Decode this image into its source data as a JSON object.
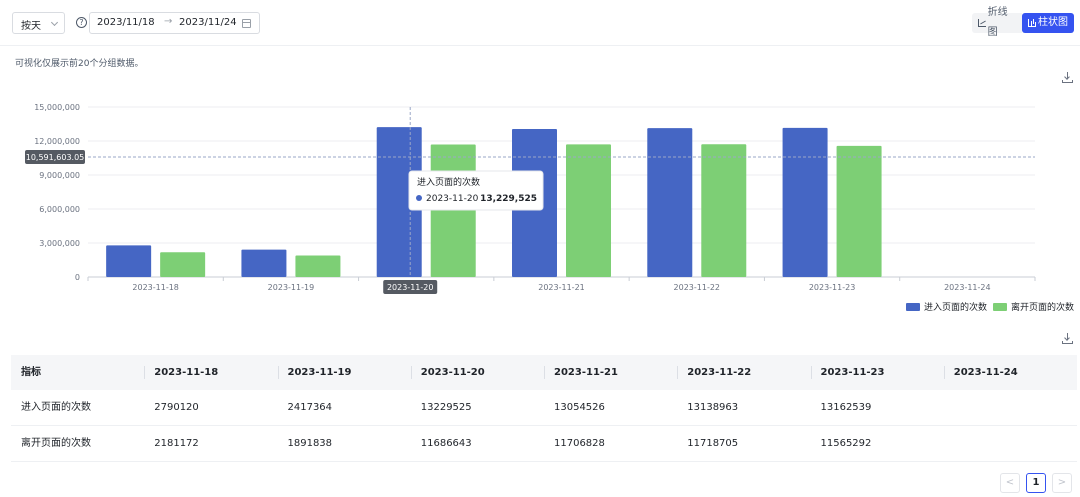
{
  "toolbar": {
    "group_by": "按天",
    "date_start": "2023/11/18",
    "date_sep": "→",
    "date_end": "2023/11/24",
    "view_line_label": "折线图",
    "view_bar_label": "柱状图"
  },
  "note": "可视化仅展示前20个分组数据。",
  "colors": {
    "enter": "#4566c4",
    "leave": "#7dcf75",
    "accent": "#3553f0"
  },
  "chart_data": {
    "type": "bar",
    "categories": [
      "2023-11-18",
      "2023-11-19",
      "2023-11-20",
      "2023-11-21",
      "2023-11-22",
      "2023-11-23",
      "2023-11-24"
    ],
    "series": [
      {
        "name": "进入页面的次数",
        "values": [
          2790120,
          2417364,
          13229525,
          13054526,
          13138963,
          13162539,
          null
        ]
      },
      {
        "name": "离开页面的次数",
        "values": [
          2181172,
          1891838,
          11686643,
          11706828,
          11718705,
          11565292,
          null
        ]
      }
    ],
    "ylim": [
      0,
      15000000
    ],
    "yticks": [
      "0",
      "3,000,000",
      "6,000,000",
      "9,000,000",
      "12,000,000",
      "15,000,000"
    ],
    "grid": true,
    "legend": "bottom-right",
    "crosshair": {
      "value_label": "10,591,603.05",
      "value": 10591603.05,
      "category_label": "2023-11-20",
      "category_index": 2
    },
    "tooltip": {
      "title": "进入页面的次数",
      "date": "2023-11-20",
      "value": "13,229,525"
    }
  },
  "legend": {
    "enter_label": "进入页面的次数",
    "leave_label": "离开页面的次数"
  },
  "table": {
    "columns": [
      "指标",
      "2023-11-18",
      "2023-11-19",
      "2023-11-20",
      "2023-11-21",
      "2023-11-22",
      "2023-11-23",
      "2023-11-24"
    ],
    "rows": [
      [
        "进入页面的次数",
        "2790120",
        "2417364",
        "13229525",
        "13054526",
        "13138963",
        "13162539",
        ""
      ],
      [
        "离开页面的次数",
        "2181172",
        "1891838",
        "11686643",
        "11706828",
        "11718705",
        "11565292",
        ""
      ]
    ]
  },
  "pager": {
    "prev": "<",
    "current": "1",
    "next": ">"
  }
}
